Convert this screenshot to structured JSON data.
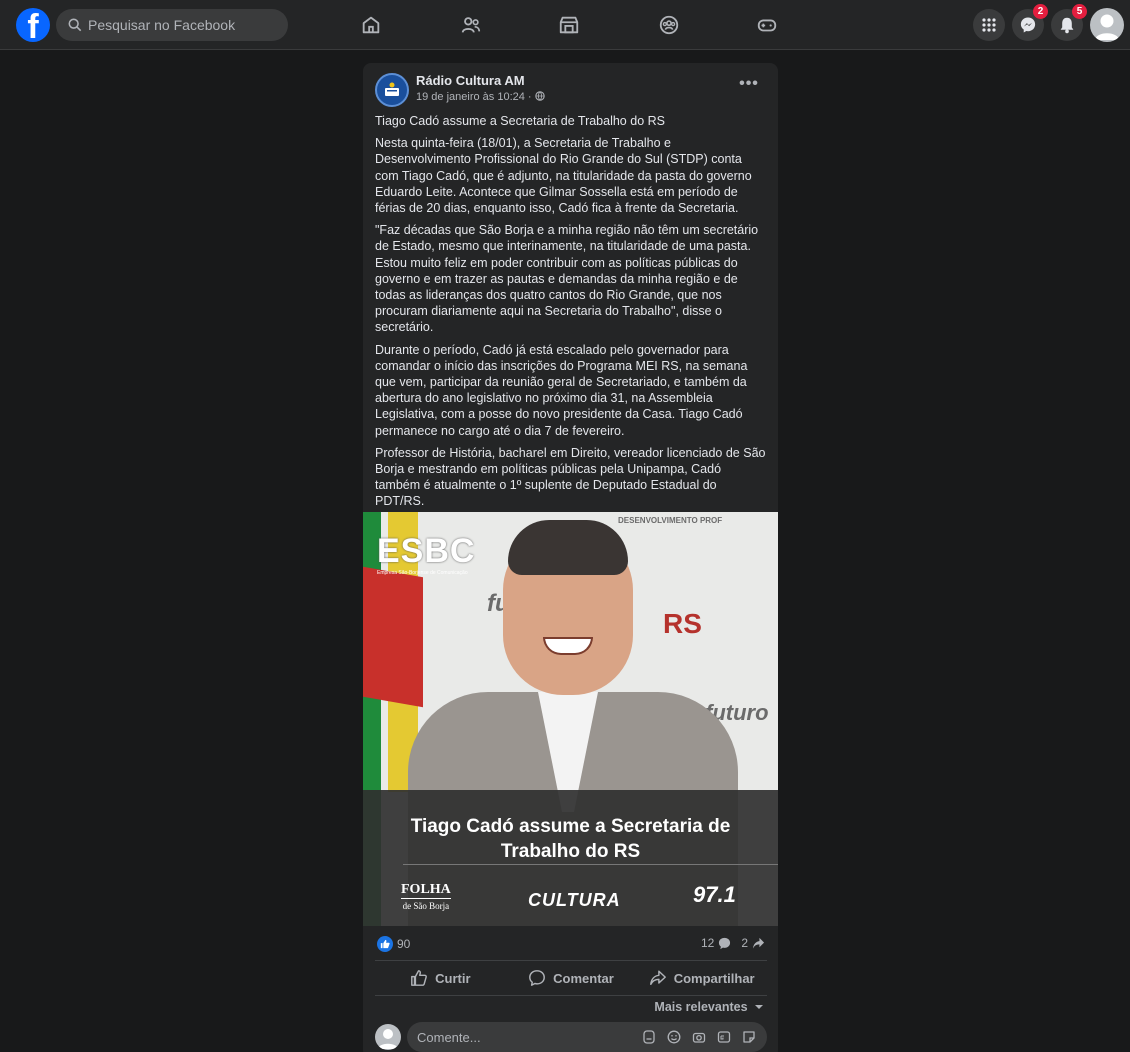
{
  "topbar": {
    "logo_letter": "f",
    "search_placeholder": "Pesquisar no Facebook",
    "nav_icons": [
      "home-icon",
      "friends-icon",
      "marketplace-icon",
      "groups-icon",
      "gaming-icon"
    ],
    "messenger_badge": "2",
    "notifications_badge": "5"
  },
  "post": {
    "page_name": "Rádio Cultura AM",
    "date": "19 de janeiro às 10:24 ·",
    "more_label": "•••",
    "paragraphs": [
      "Tiago Cadó assume a Secretaria de Trabalho do RS",
      "Nesta quinta-feira (18/01), a Secretaria de Trabalho e Desenvolvimento Profissional do Rio Grande do Sul (STDP) conta com Tiago Cadó, que é adjunto, na titularidade da pasta do governo Eduardo Leite. Acontece que Gilmar Sossella está em período de férias de 20 dias, enquanto isso, Cadó fica à frente da Secretaria.",
      "\"Faz décadas que São Borja e a minha região não têm um secretário de Estado, mesmo que interinamente, na titularidade de uma pasta. Estou muito feliz em poder contribuir com as políticas públicas do governo e em trazer as pautas e demandas da minha região e de todas as lideranças dos quatro cantos do Rio Grande, que nos procuram diariamente aqui na Secretaria do Trabalho\", disse o secretário.",
      "Durante o período, Cadó já está escalado pelo governador para comandar o início das inscrições do Programa MEI RS, na semana que vem, participar da reunião geral de Secretariado, e também da abertura do ano legislativo no próximo dia 31, na Assembleia Legislativa, com a posse do novo presidente da Casa. Tiago Cadó permanece no cargo até o dia 7 de fevereiro.",
      "Professor de História, bacharel em Direito, vereador licenciado de São Borja e mestrando em políticas públicas pela Unipampa, Cadó também é atualmente o 1º suplente de Deputado Estadual do PDT/RS."
    ],
    "image": {
      "brand_logo": "ESBC",
      "brand_sub": "Empresa São-Borjense de Comunicação",
      "wall_text_1": "futuro",
      "wall_text_2": "RS",
      "wall_text_3": "DESENVOLVIMENTO PROF",
      "wall_text_4": "futuro",
      "caption": "Tiago Cadó assume a Secretaria de Trabalho do RS",
      "logo_folha_1": "FOLHA",
      "logo_folha_2": "de São Borja",
      "logo_cultura": "CULTURA",
      "logo_971": "97.1"
    },
    "stats": {
      "likes": "90",
      "comments": "12",
      "shares": "2"
    },
    "actions": {
      "like": "Curtir",
      "comment": "Comentar",
      "share": "Compartilhar"
    },
    "sort_label": "Mais relevantes",
    "comment_placeholder": "Comente..."
  },
  "colors": {
    "background": "#18191a",
    "card": "#242526",
    "brand_blue": "#0866ff",
    "badge_red": "#e41e3f"
  }
}
